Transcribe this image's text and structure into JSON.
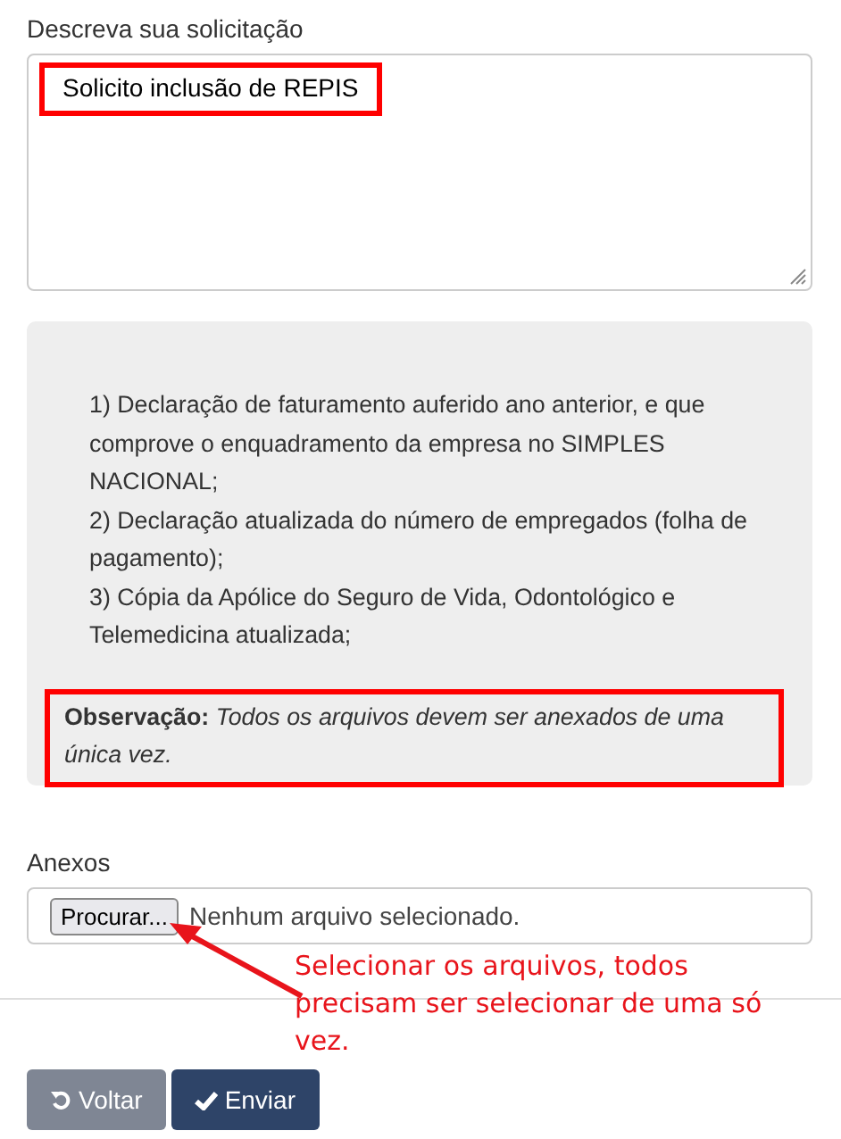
{
  "description": {
    "label": "Descreva sua solicitação",
    "value": "Solicito inclusão de REPIS",
    "highlighted": true
  },
  "requirements": {
    "lines": [
      "1) Declaração de faturamento auferido ano anterior,  e que comprove o enquadramento da empresa no SIMPLES NACIONAL;",
      "2) Declaração atualizada do número de empregados (folha de pagamento);",
      "3) Cópia da Apólice do Seguro de Vida, Odontológico e Telemedicina atualizada;"
    ],
    "note": "**Observação:** *Todos os arquivos devem ser anexados de uma única vez.*",
    "note_highlighted": true
  },
  "attachments": {
    "label": "Anexos",
    "button": "Procurar...",
    "status": "Nenhum arquivo selecionado."
  },
  "annotation": "Selecionar os arquivos, todos precisam ser selecionar de uma só vez.",
  "buttons": [
    {
      "kind": "back",
      "label": "Voltar"
    },
    {
      "kind": "submit",
      "label": "Enviar"
    }
  ]
}
